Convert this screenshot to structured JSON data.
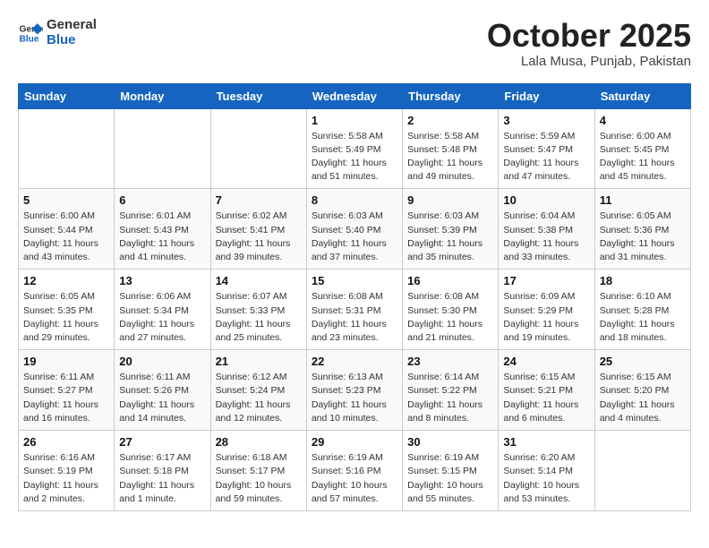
{
  "header": {
    "logo_line1": "General",
    "logo_line2": "Blue",
    "month": "October 2025",
    "location": "Lala Musa, Punjab, Pakistan"
  },
  "weekdays": [
    "Sunday",
    "Monday",
    "Tuesday",
    "Wednesday",
    "Thursday",
    "Friday",
    "Saturday"
  ],
  "weeks": [
    [
      {
        "day": "",
        "info": ""
      },
      {
        "day": "",
        "info": ""
      },
      {
        "day": "",
        "info": ""
      },
      {
        "day": "1",
        "info": "Sunrise: 5:58 AM\nSunset: 5:49 PM\nDaylight: 11 hours\nand 51 minutes."
      },
      {
        "day": "2",
        "info": "Sunrise: 5:58 AM\nSunset: 5:48 PM\nDaylight: 11 hours\nand 49 minutes."
      },
      {
        "day": "3",
        "info": "Sunrise: 5:59 AM\nSunset: 5:47 PM\nDaylight: 11 hours\nand 47 minutes."
      },
      {
        "day": "4",
        "info": "Sunrise: 6:00 AM\nSunset: 5:45 PM\nDaylight: 11 hours\nand 45 minutes."
      }
    ],
    [
      {
        "day": "5",
        "info": "Sunrise: 6:00 AM\nSunset: 5:44 PM\nDaylight: 11 hours\nand 43 minutes."
      },
      {
        "day": "6",
        "info": "Sunrise: 6:01 AM\nSunset: 5:43 PM\nDaylight: 11 hours\nand 41 minutes."
      },
      {
        "day": "7",
        "info": "Sunrise: 6:02 AM\nSunset: 5:41 PM\nDaylight: 11 hours\nand 39 minutes."
      },
      {
        "day": "8",
        "info": "Sunrise: 6:03 AM\nSunset: 5:40 PM\nDaylight: 11 hours\nand 37 minutes."
      },
      {
        "day": "9",
        "info": "Sunrise: 6:03 AM\nSunset: 5:39 PM\nDaylight: 11 hours\nand 35 minutes."
      },
      {
        "day": "10",
        "info": "Sunrise: 6:04 AM\nSunset: 5:38 PM\nDaylight: 11 hours\nand 33 minutes."
      },
      {
        "day": "11",
        "info": "Sunrise: 6:05 AM\nSunset: 5:36 PM\nDaylight: 11 hours\nand 31 minutes."
      }
    ],
    [
      {
        "day": "12",
        "info": "Sunrise: 6:05 AM\nSunset: 5:35 PM\nDaylight: 11 hours\nand 29 minutes."
      },
      {
        "day": "13",
        "info": "Sunrise: 6:06 AM\nSunset: 5:34 PM\nDaylight: 11 hours\nand 27 minutes."
      },
      {
        "day": "14",
        "info": "Sunrise: 6:07 AM\nSunset: 5:33 PM\nDaylight: 11 hours\nand 25 minutes."
      },
      {
        "day": "15",
        "info": "Sunrise: 6:08 AM\nSunset: 5:31 PM\nDaylight: 11 hours\nand 23 minutes."
      },
      {
        "day": "16",
        "info": "Sunrise: 6:08 AM\nSunset: 5:30 PM\nDaylight: 11 hours\nand 21 minutes."
      },
      {
        "day": "17",
        "info": "Sunrise: 6:09 AM\nSunset: 5:29 PM\nDaylight: 11 hours\nand 19 minutes."
      },
      {
        "day": "18",
        "info": "Sunrise: 6:10 AM\nSunset: 5:28 PM\nDaylight: 11 hours\nand 18 minutes."
      }
    ],
    [
      {
        "day": "19",
        "info": "Sunrise: 6:11 AM\nSunset: 5:27 PM\nDaylight: 11 hours\nand 16 minutes."
      },
      {
        "day": "20",
        "info": "Sunrise: 6:11 AM\nSunset: 5:26 PM\nDaylight: 11 hours\nand 14 minutes."
      },
      {
        "day": "21",
        "info": "Sunrise: 6:12 AM\nSunset: 5:24 PM\nDaylight: 11 hours\nand 12 minutes."
      },
      {
        "day": "22",
        "info": "Sunrise: 6:13 AM\nSunset: 5:23 PM\nDaylight: 11 hours\nand 10 minutes."
      },
      {
        "day": "23",
        "info": "Sunrise: 6:14 AM\nSunset: 5:22 PM\nDaylight: 11 hours\nand 8 minutes."
      },
      {
        "day": "24",
        "info": "Sunrise: 6:15 AM\nSunset: 5:21 PM\nDaylight: 11 hours\nand 6 minutes."
      },
      {
        "day": "25",
        "info": "Sunrise: 6:15 AM\nSunset: 5:20 PM\nDaylight: 11 hours\nand 4 minutes."
      }
    ],
    [
      {
        "day": "26",
        "info": "Sunrise: 6:16 AM\nSunset: 5:19 PM\nDaylight: 11 hours\nand 2 minutes."
      },
      {
        "day": "27",
        "info": "Sunrise: 6:17 AM\nSunset: 5:18 PM\nDaylight: 11 hours\nand 1 minute."
      },
      {
        "day": "28",
        "info": "Sunrise: 6:18 AM\nSunset: 5:17 PM\nDaylight: 10 hours\nand 59 minutes."
      },
      {
        "day": "29",
        "info": "Sunrise: 6:19 AM\nSunset: 5:16 PM\nDaylight: 10 hours\nand 57 minutes."
      },
      {
        "day": "30",
        "info": "Sunrise: 6:19 AM\nSunset: 5:15 PM\nDaylight: 10 hours\nand 55 minutes."
      },
      {
        "day": "31",
        "info": "Sunrise: 6:20 AM\nSunset: 5:14 PM\nDaylight: 10 hours\nand 53 minutes."
      },
      {
        "day": "",
        "info": ""
      }
    ]
  ]
}
